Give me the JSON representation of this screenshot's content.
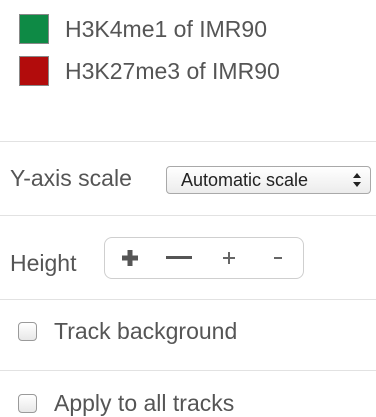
{
  "legend": {
    "items": [
      {
        "label": "H3K4me1 of IMR90",
        "color": "#0e8a45"
      },
      {
        "label": "H3K27me3 of IMR90",
        "color": "#b20c0c"
      }
    ]
  },
  "yaxis": {
    "label": "Y-axis scale",
    "selected": "Automatic scale",
    "icon": "updown-arrows-icon"
  },
  "height": {
    "label": "Height",
    "buttons": [
      {
        "name": "increase-large",
        "icon": "plus-bold-icon"
      },
      {
        "name": "decrease-large",
        "icon": "minus-bold-icon"
      },
      {
        "name": "increase-small",
        "icon": "plus-small-icon"
      },
      {
        "name": "decrease-small",
        "icon": "minus-small-icon"
      }
    ]
  },
  "options": {
    "track_background": {
      "label": "Track background",
      "checked": false
    },
    "apply_all": {
      "label": "Apply to all tracks",
      "checked": false
    }
  }
}
